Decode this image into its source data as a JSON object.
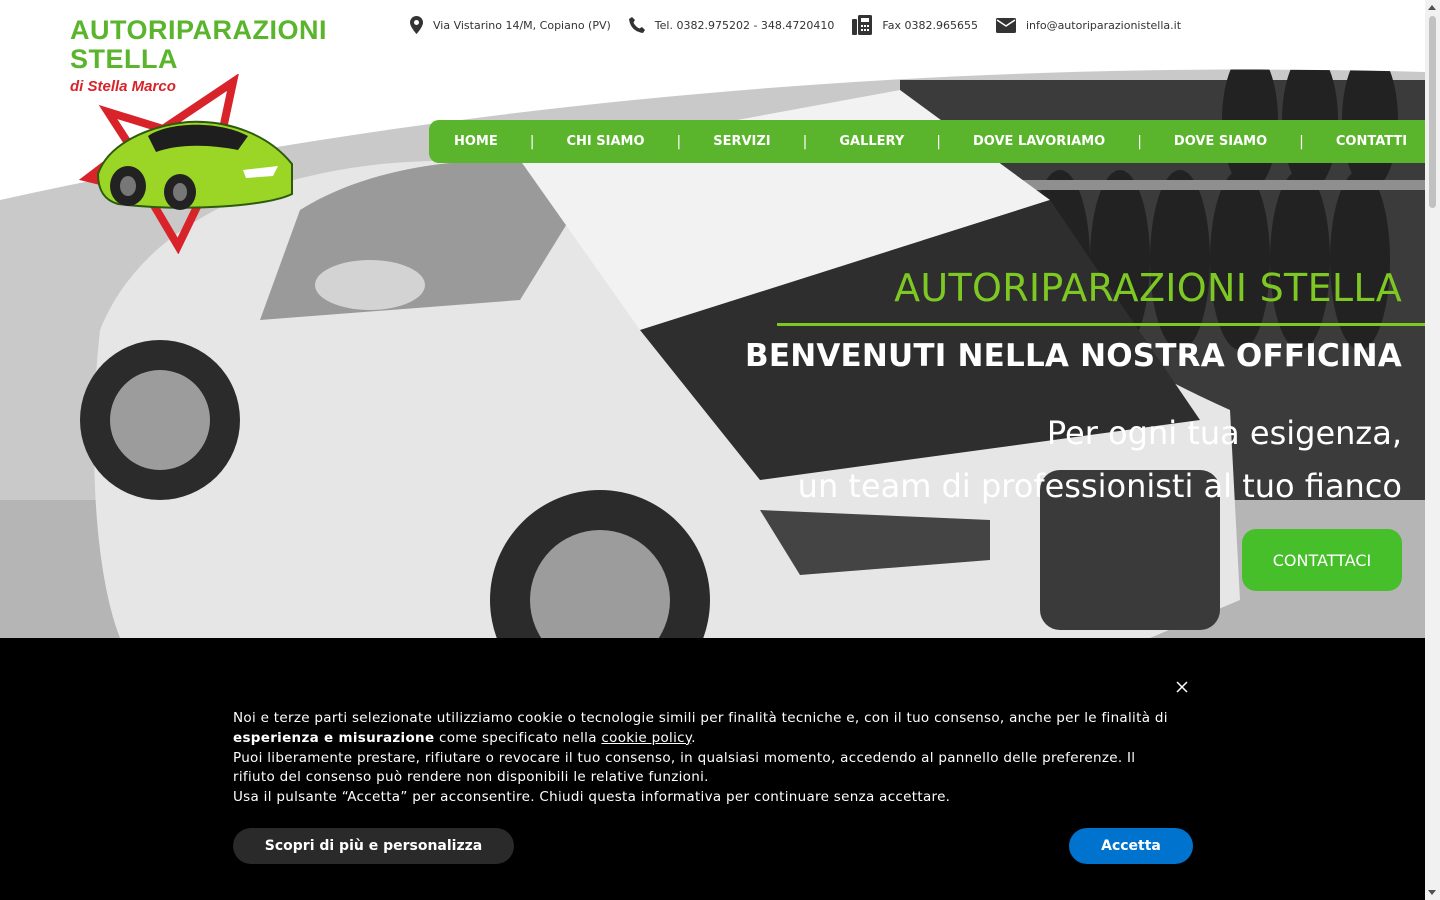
{
  "brand": {
    "line1": "AUTORIPARAZIONI",
    "line2": "STELLA",
    "sub": "di Stella Marco",
    "green": "#5ab52c",
    "red": "#d8232a"
  },
  "topbar": {
    "address": "Via Vistarino 14/M, Copiano (PV)",
    "phone": "Tel. 0382.975202 - 348.4720410",
    "fax": "Fax 0382.965655",
    "email": "info@autoriparazionistella.it",
    "icons": [
      "map-pin-icon",
      "phone-icon",
      "fax-icon",
      "envelope-icon"
    ]
  },
  "nav": {
    "items": [
      "HOME",
      "CHI SIAMO",
      "SERVIZI",
      "GALLERY",
      "DOVE LAVORIAMO",
      "DOVE SIAMO",
      "CONTATTI"
    ],
    "separator": "|",
    "color": "#5ab52c"
  },
  "hero": {
    "title": "AUTORIPARAZIONI STELLA",
    "subtitle": "BENVENUTI NELLA NOSTRA OFFICINA",
    "tagline1": "Per ogni tua esigenza,",
    "tagline2": "un team di professionisti al tuo fianco",
    "cta": "CONTATTACI",
    "title_color": "#7ec823",
    "cta_color": "#46bf2a"
  },
  "cookie": {
    "text_part1": "Noi e terze parti selezionate utilizziamo cookie o tecnologie simili per finalità tecniche e, con il tuo consenso, anche per le finalità di ",
    "text_bold": "esperienza e misurazione",
    "text_part2": " come specificato nella ",
    "link": "cookie policy",
    "text_part3": ".",
    "line2": "Puoi liberamente prestare, rifiutare o revocare il tuo consenso, in qualsiasi momento, accedendo al pannello delle preferenze. Il rifiuto del consenso può rendere non disponibili le relative funzioni.",
    "line3": "Usa il pulsante “Accetta” per acconsentire. Chiudi questa informativa per continuare senza accettare.",
    "more_button": "Scopri di più e personalizza",
    "accept_button": "Accetta",
    "accept_color": "#0073ce"
  }
}
